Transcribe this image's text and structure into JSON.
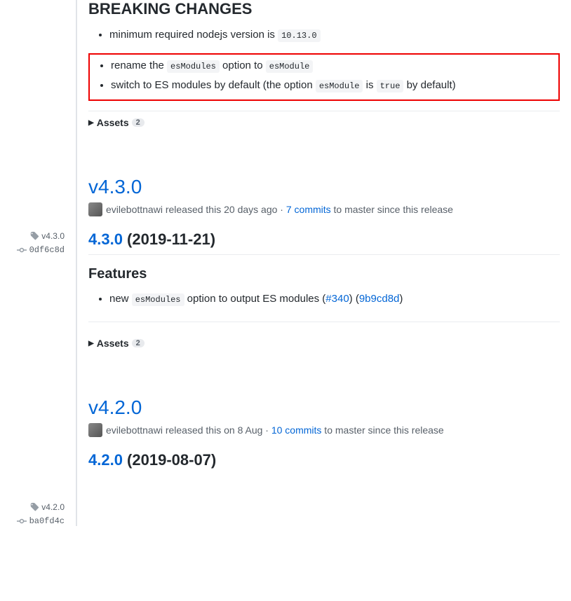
{
  "breaking": {
    "title": "BREAKING CHANGES",
    "item1_prefix": "minimum required nodejs version is ",
    "item1_code": "10.13.0",
    "item2_prefix": "rename the ",
    "item2_code1": "esModules",
    "item2_mid": " option to ",
    "item2_code2": "esModule",
    "item3_prefix": "switch to ES modules by default (the option ",
    "item3_code1": "esModule",
    "item3_mid1": " is ",
    "item3_code2": "true",
    "item3_suffix": " by default)"
  },
  "assets": {
    "label": "Assets",
    "count": "2"
  },
  "r430": {
    "tag": "v4.3.0",
    "commit": "0df6c8d",
    "title": "v4.3.0",
    "author": "evilebottnawi",
    "released_prefix": " released this ",
    "released_time": "20 days ago",
    "dot": " · ",
    "commits_link": "7 commits",
    "commits_suffix": " to master since this release",
    "inner_ver": "4.3.0",
    "inner_date": " (2019-11-21)",
    "features_heading": "Features",
    "feat1_prefix": "new ",
    "feat1_code": "esModules",
    "feat1_mid": " option to output ES modules (",
    "feat1_link1": "#340",
    "feat1_mid2": ") (",
    "feat1_link2": "9b9cd8d",
    "feat1_suffix": ")"
  },
  "r420": {
    "tag": "v4.2.0",
    "commit": "ba0fd4c",
    "title": "v4.2.0",
    "author": "evilebottnawi",
    "released_prefix": " released this ",
    "released_time": "on 8 Aug",
    "dot": " · ",
    "commits_link": "10 commits",
    "commits_suffix": " to master since this release",
    "inner_ver": "4.2.0",
    "inner_date": " (2019-08-07)"
  }
}
